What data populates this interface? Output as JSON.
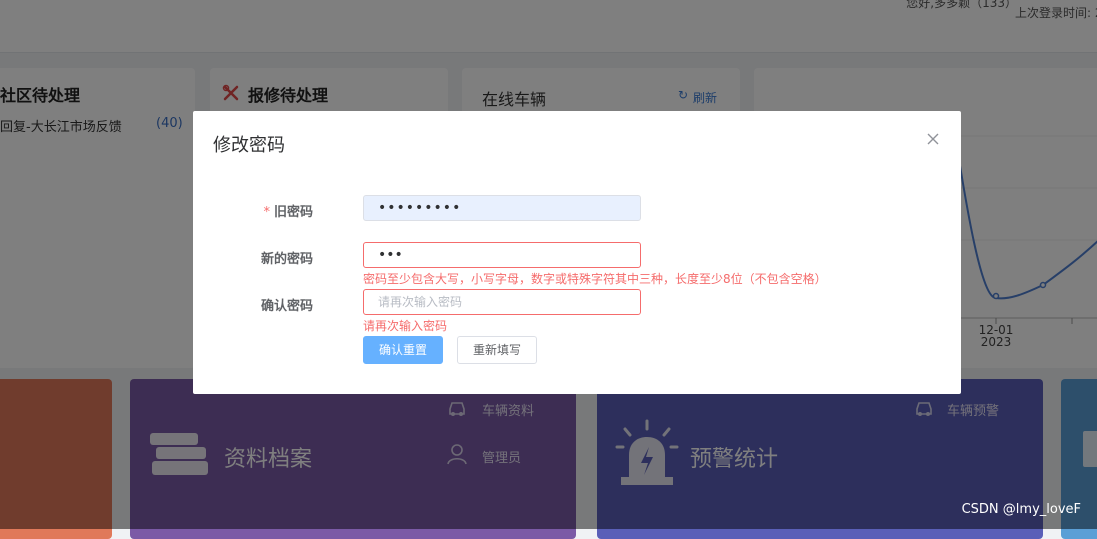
{
  "header": {
    "greeting": "您好,多多颖（133）",
    "last_login": "上次登录时间: 2"
  },
  "cards": {
    "community": {
      "title": "社区待处理",
      "item_text": "回复-大长江市场反馈",
      "item_count": "(40)"
    },
    "repair": {
      "title": "报修待处理"
    },
    "online": {
      "title": "在线车辆",
      "refresh": "刷新"
    },
    "chart": {
      "x_label": "12-01",
      "x_year": "2023"
    }
  },
  "tiles": {
    "archive": {
      "label": "资料档案",
      "link1": "车辆资料",
      "link2": "管理员"
    },
    "alert": {
      "label": "预警统计",
      "link1": "车辆预警"
    }
  },
  "dialog": {
    "title": "修改密码",
    "old_password": {
      "label": "旧密码",
      "required": "*",
      "value": "•••••••••"
    },
    "new_password": {
      "label": "新的密码",
      "value": "•••",
      "error": "密码至少包含大写，小写字母，数字或特殊字符其中三种，长度至少8位（不包含空格）"
    },
    "confirm_password": {
      "label": "确认密码",
      "placeholder": "请再次输入密码",
      "error": "请再次输入密码"
    },
    "submit_label": "确认重置",
    "reset_label": "重新填写"
  },
  "watermark": "CSDN @lmy_loveF",
  "colors": {
    "primary": "#66b1ff",
    "error": "#f56c6c",
    "purple_tile": "#7b5aa6",
    "indigo_tile": "#5a5fb8"
  }
}
